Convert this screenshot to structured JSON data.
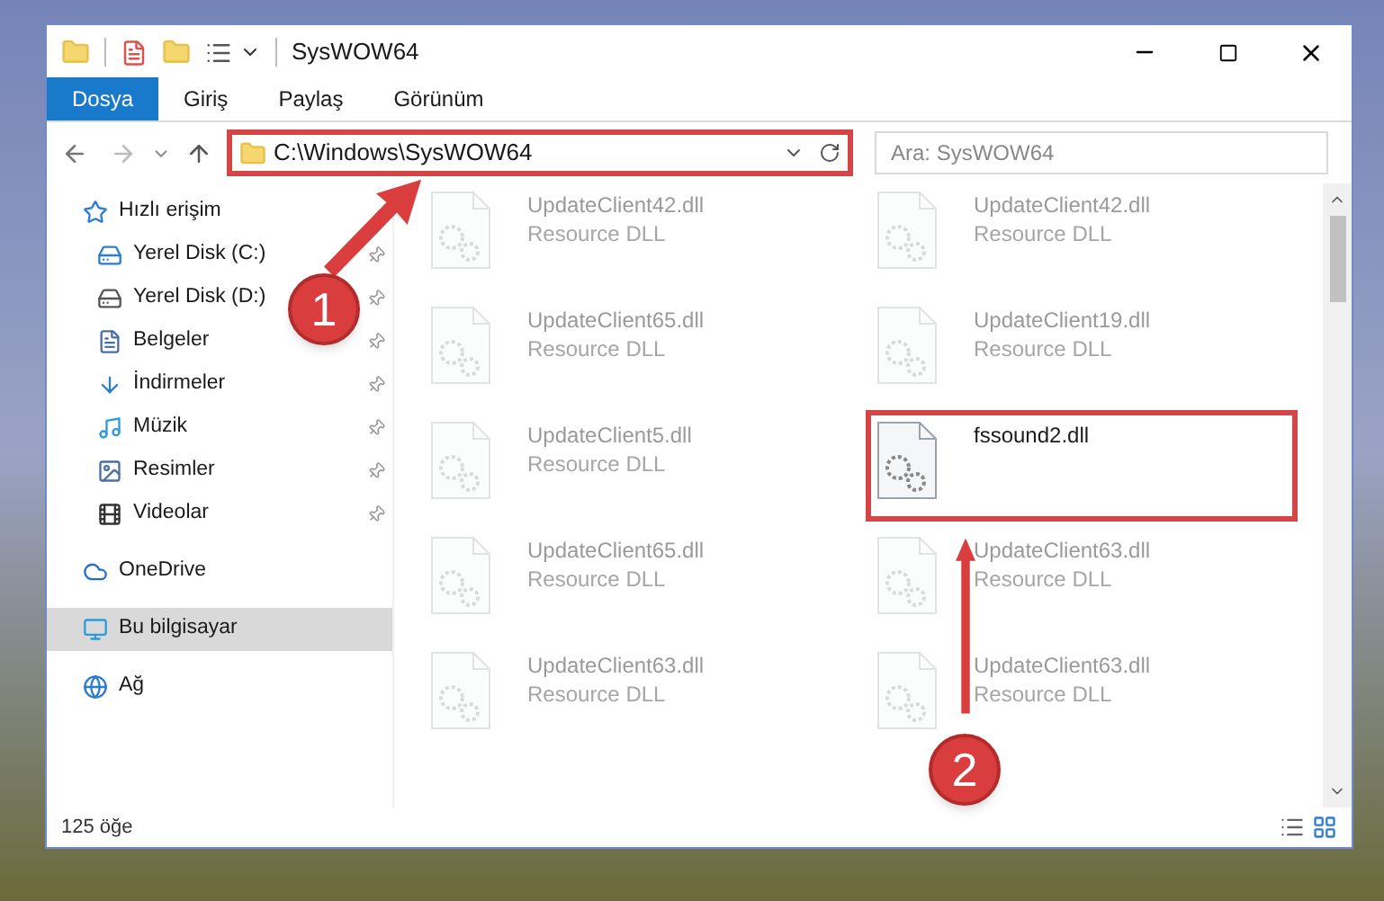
{
  "window": {
    "title": "SysWOW64"
  },
  "ribbon_tabs": [
    {
      "label": "Dosya",
      "selected": true
    },
    {
      "label": "Giriş",
      "selected": false
    },
    {
      "label": "Paylaş",
      "selected": false
    },
    {
      "label": "Görünüm",
      "selected": false
    }
  ],
  "address_bar": {
    "path": "C:\\Windows\\SysWOW64",
    "highlighted": true
  },
  "search": {
    "placeholder": "Ara: SysWOW64"
  },
  "sidebar": {
    "items": [
      {
        "label": "Hızlı erişim",
        "kind": "star",
        "selected": false,
        "children": [
          {
            "label": "Yerel Disk (C:)",
            "kind": "system-drive",
            "pinned": true
          },
          {
            "label": "Yerel Disk (D:)",
            "kind": "drive",
            "pinned": true
          },
          {
            "label": "Belgeler",
            "kind": "document",
            "pinned": true
          },
          {
            "label": "İndirmeler",
            "kind": "download",
            "pinned": true
          },
          {
            "label": "Müzik",
            "kind": "music",
            "pinned": true
          },
          {
            "label": "Resimler",
            "kind": "picture",
            "pinned": true
          },
          {
            "label": "Videolar",
            "kind": "film",
            "pinned": true
          }
        ]
      },
      {
        "label": "OneDrive",
        "kind": "cloud",
        "selected": false
      },
      {
        "label": "Bu bilgisayar",
        "kind": "computer",
        "selected": true
      },
      {
        "label": "Ağ",
        "kind": "network",
        "selected": false
      }
    ]
  },
  "files": [
    {
      "name": "UpdateClient42.dll",
      "type": "Resource DLL",
      "dimmed": true,
      "highlighted": false
    },
    {
      "name": "UpdateClient42.dll",
      "type": "Resource DLL",
      "dimmed": true,
      "highlighted": false
    },
    {
      "name": "UpdateClient65.dll",
      "type": "Resource DLL",
      "dimmed": true,
      "highlighted": false
    },
    {
      "name": "UpdateClient19.dll",
      "type": "Resource DLL",
      "dimmed": true,
      "highlighted": false
    },
    {
      "name": "UpdateClient5.dll",
      "type": "Resource DLL",
      "dimmed": true,
      "highlighted": false
    },
    {
      "name": "fssound2.dll",
      "dimmed": false,
      "highlighted": true
    },
    {
      "name": "UpdateClient65.dll",
      "type": "Resource DLL",
      "dimmed": true,
      "highlighted": false
    },
    {
      "name": "UpdateClient63.dll",
      "type": "Resource DLL",
      "dimmed": true,
      "highlighted": false
    },
    {
      "name": "UpdateClient63.dll",
      "type": "Resource DLL",
      "dimmed": true,
      "highlighted": false
    },
    {
      "name": "UpdateClient63.dll",
      "type": "Resource DLL",
      "dimmed": true,
      "highlighted": false
    }
  ],
  "status_bar": {
    "count": "125 öğe"
  },
  "annotations": [
    {
      "number": "1"
    },
    {
      "number": "2"
    }
  ]
}
